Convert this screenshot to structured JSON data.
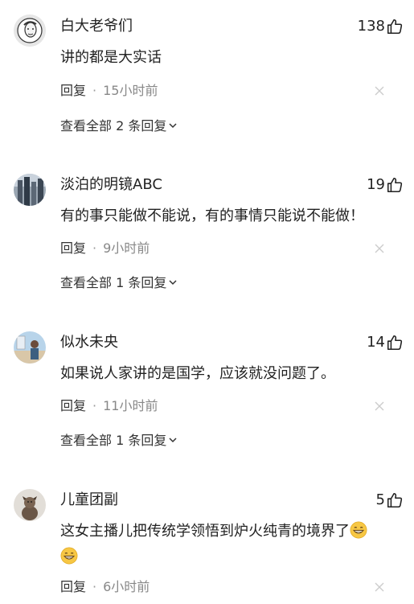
{
  "comments": [
    {
      "username": "白大老爷们",
      "likes": "138",
      "content": "讲的都是大实话",
      "reply_label": "回复",
      "separator": "·",
      "time": "15小时前",
      "view_replies": "查看全部 2 条回复"
    },
    {
      "username": "淡泊的明镜ABC",
      "likes": "19",
      "content": "有的事只能做不能说，有的事情只能说不能做！",
      "reply_label": "回复",
      "separator": "·",
      "time": "9小时前",
      "view_replies": "查看全部 1 条回复"
    },
    {
      "username": "似水未央",
      "likes": "14",
      "content": "如果说人家讲的是国学，应该就没问题了。",
      "reply_label": "回复",
      "separator": "·",
      "time": "11小时前",
      "view_replies": "查看全部 1 条回复"
    },
    {
      "username": "儿童团副",
      "likes": "5",
      "content": "这女主播儿把传统学领悟到炉火纯青的境界了",
      "reply_label": "回复",
      "separator": "·",
      "time": "6小时前"
    }
  ],
  "icons": {
    "like": "thumbs-up-icon",
    "close": "close-icon",
    "chevron": "chevron-down-icon",
    "emoji": "grin-emoji-icon"
  },
  "colors": {
    "text": "#222222",
    "meta": "#888888",
    "close": "#cccccc",
    "emoji": "#f7c744"
  }
}
